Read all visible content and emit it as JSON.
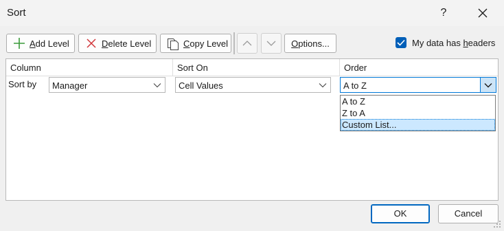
{
  "window": {
    "title": "Sort",
    "help_label": "?"
  },
  "toolbar": {
    "add_level": {
      "key": "A",
      "rest": "dd Level"
    },
    "delete_level": {
      "key": "D",
      "rest": "elete Level"
    },
    "copy_level": {
      "key": "C",
      "rest": "opy Level"
    },
    "options": {
      "key": "O",
      "rest": "ptions..."
    },
    "headers_checkbox": {
      "checked": true,
      "pre": "My data has ",
      "key": "h",
      "rest": "eaders"
    }
  },
  "grid": {
    "headers": {
      "column": "Column",
      "sort_on": "Sort On",
      "order": "Order"
    },
    "rows": [
      {
        "label": "Sort by",
        "column_value": "Manager",
        "sort_on_value": "Cell Values",
        "order_value": "A to Z"
      }
    ],
    "order_dropdown": {
      "open": true,
      "options": [
        "A to Z",
        "Z to A",
        "Custom List..."
      ],
      "highlighted_index": 2
    }
  },
  "footer": {
    "ok": "OK",
    "cancel": "Cancel"
  },
  "colors": {
    "accent": "#005fb8",
    "add_icon": "#3a9a3a",
    "delete_icon": "#d13438",
    "selection": "#cce8ff"
  }
}
